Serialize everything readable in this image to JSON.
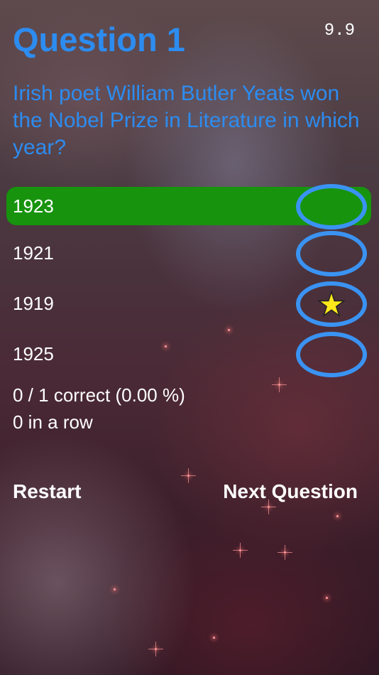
{
  "header": {
    "title": "Question 1",
    "timer": "9.9"
  },
  "question": {
    "text": "Irish poet William Butler Yeats won the Nobel Prize in Literature in which year?"
  },
  "answers": [
    {
      "label": "1923",
      "state": "correct"
    },
    {
      "label": "1921",
      "state": "none"
    },
    {
      "label": "1919",
      "state": "selected-star"
    },
    {
      "label": "1925",
      "state": "none"
    }
  ],
  "stats": {
    "score": "0 / 1 correct (0.00 %)",
    "streak": "0 in a row"
  },
  "actions": {
    "restart": "Restart",
    "next": "Next Question"
  },
  "colors": {
    "accent": "#2d8cf0",
    "correct": "#17930e",
    "radio_ring": "#3a93f2",
    "star": "#ffe81a"
  },
  "icons": {
    "star": "star-icon"
  }
}
